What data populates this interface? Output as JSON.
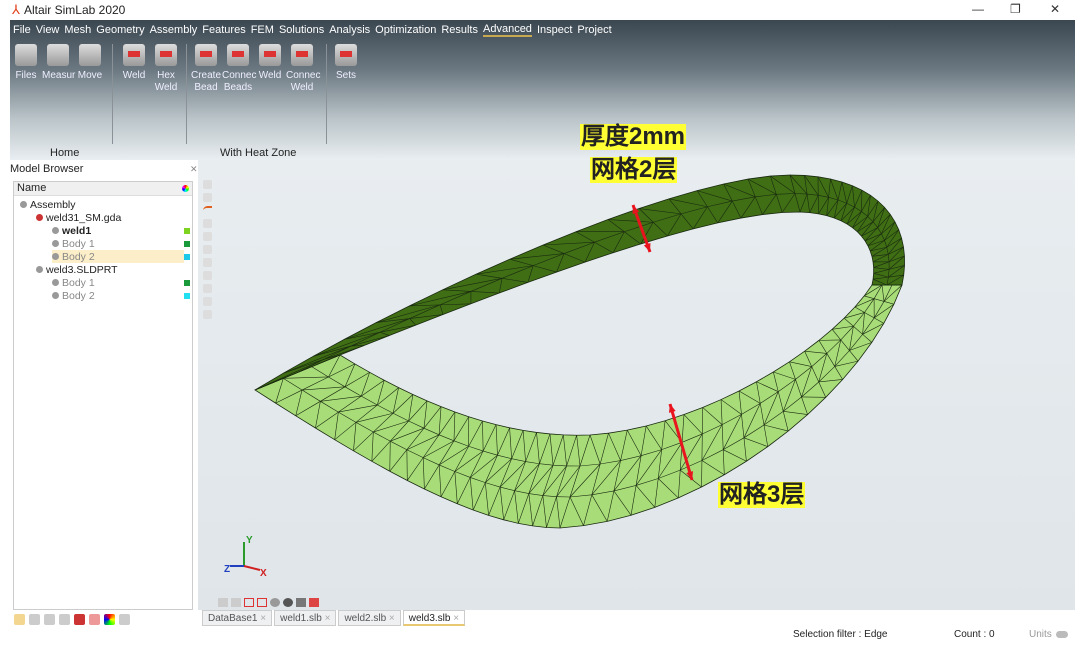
{
  "app": {
    "title": "Altair SimLab 2020",
    "window_controls": [
      "minimize",
      "restore",
      "close"
    ]
  },
  "menu": [
    "File",
    "View",
    "Mesh",
    "Geometry",
    "Assembly",
    "Features",
    "FEM",
    "Solutions",
    "Analysis",
    "Optimization",
    "Results",
    "Advanced",
    "Inspect",
    "Project"
  ],
  "active_menu": "Advanced",
  "ribbon": {
    "home_tools": [
      {
        "label": "Files",
        "icon": "files-icon"
      },
      {
        "label": "Measur",
        "icon": "measure-icon"
      },
      {
        "label": "Move",
        "icon": "move-icon"
      }
    ],
    "weld_tools": [
      {
        "label": "Weld",
        "icon": "weld-icon"
      },
      {
        "label": "Hex Weld",
        "icon": "hex-weld-icon"
      }
    ],
    "heat_tools": [
      {
        "label": "Create Bead",
        "icon": "create-bead-icon"
      },
      {
        "label": "Connec Beads",
        "icon": "connect-beads-icon"
      },
      {
        "label": "Weld",
        "icon": "weld-heat-icon"
      },
      {
        "label": "Connec Weld",
        "icon": "connect-weld-icon"
      }
    ],
    "set_tools": [
      {
        "label": "Sets",
        "icon": "sets-icon"
      }
    ],
    "groups": {
      "home": "Home",
      "heat": "With Heat Zone"
    }
  },
  "model_browser": {
    "title": "Model Browser",
    "column": "Name",
    "tree": [
      {
        "label": "Assembly",
        "level": 0
      },
      {
        "label": "weld31_SM.gda",
        "level": 1
      },
      {
        "label": "weld1",
        "level": 2,
        "color": "#7ed321",
        "bold": true
      },
      {
        "label": "Body 1",
        "level": 2,
        "color": "#1a9a3a"
      },
      {
        "label": "Body 2",
        "level": 2,
        "color": "#1ec8e8",
        "selected": true
      },
      {
        "label": "weld3.SLDPRT",
        "level": 1
      },
      {
        "label": "Body 1",
        "level": 2,
        "color": "#1a9a3a"
      },
      {
        "label": "Body 2",
        "level": 2,
        "color": "#22e0f0"
      }
    ]
  },
  "doc_tabs": [
    "DataBase1",
    "weld1.slb",
    "weld2.slb",
    "weld3.slb"
  ],
  "active_tab": "weld3.slb",
  "status": {
    "selection_filter": "Selection filter : Edge",
    "count": "Count : 0",
    "units": "Units"
  },
  "annotations": {
    "thickness": "厚度2mm",
    "layers_top": "网格2层",
    "layers_bottom": "网格3层"
  },
  "axes": {
    "x": "X",
    "y": "Y",
    "z": "Z"
  },
  "colors": {
    "dark_band": "#3f6e14",
    "light_band": "#a8dc78",
    "arrow": "#e8141e",
    "highlight": "#ffff33"
  }
}
